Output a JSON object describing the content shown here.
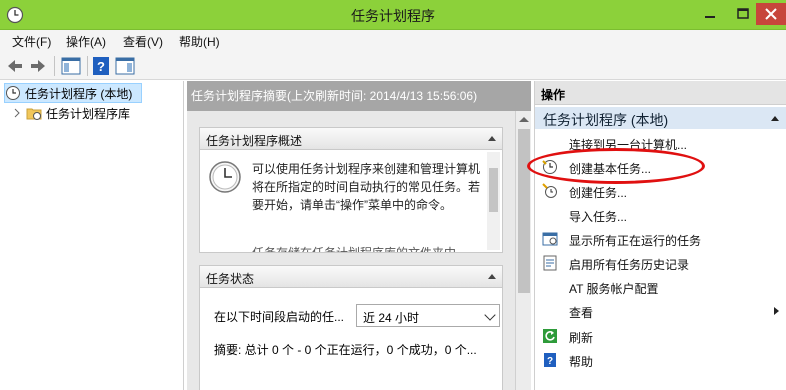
{
  "window": {
    "title": "任务计划程序"
  },
  "menu": [
    "文件(F)",
    "操作(A)",
    "查看(V)",
    "帮助(H)"
  ],
  "toolbar": {
    "icons": [
      "back-arrow-icon",
      "forward-arrow-icon",
      "show-tree-icon",
      "help-icon",
      "show-action-pane-icon"
    ]
  },
  "tree": {
    "root_label": "任务计划程序 (本地)",
    "child_label": "任务计划程序库"
  },
  "summary": {
    "header": "任务计划程序摘要(上次刷新时间: 2014/4/13 15:56:06)",
    "overview_title": "任务计划程序概述",
    "overview_text": "可以使用任务计划程序来创建和管理计算机将在所指定的时间自动执行的常见任务。若要开始，请单击“操作”菜单中的命令。",
    "overview_text2": "任务存储在任务计划程序库的文件夹中",
    "status_title": "任务状态",
    "status_label": "在以下时间段启动的任...",
    "status_select": "近 24 小时",
    "status_summary": "摘要: 总计 0 个 - 0 个正在运行，0 个成功，0 个..."
  },
  "actions": {
    "title": "操作",
    "group": "任务计划程序 (本地)",
    "items": [
      {
        "label": "连接到另一台计算机...",
        "icon": "none"
      },
      {
        "label": "创建基本任务...",
        "icon": "basic-task-icon"
      },
      {
        "label": "创建任务...",
        "icon": "create-task-icon"
      },
      {
        "label": "导入任务...",
        "icon": "none"
      },
      {
        "label": "显示所有正在运行的任务",
        "icon": "running-tasks-icon"
      },
      {
        "label": "启用所有任务历史记录",
        "icon": "task-history-icon"
      },
      {
        "label": "AT 服务帐户配置",
        "icon": "none"
      },
      {
        "label": "查看",
        "icon": "none"
      },
      {
        "label": "刷新",
        "icon": "refresh-icon"
      },
      {
        "label": "帮助",
        "icon": "help-icon"
      }
    ]
  },
  "colors": {
    "titlebar": "#8cd13a",
    "close_button": "#c7463b",
    "selection": "#cce8ff",
    "annotation_ellipse": "#e01010"
  }
}
